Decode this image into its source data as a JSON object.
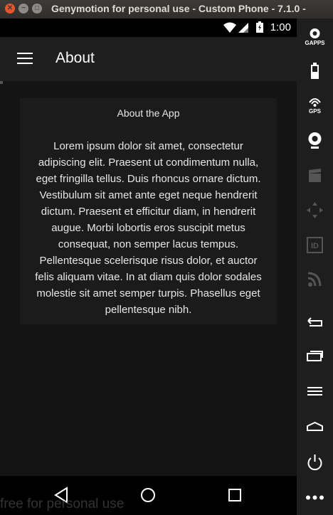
{
  "window": {
    "title": "Genymotion for personal use - Custom Phone - 7.1.0 -"
  },
  "statusbar": {
    "time": "1:00"
  },
  "appbar": {
    "title": "About"
  },
  "card": {
    "title": "About the App",
    "body": "Lorem ipsum dolor sit amet, consectetur adipiscing elit. Praesent ut condimentum nulla, eget fringilla tellus. Duis rhoncus ornare dictum. Vestibulum sit amet ante eget neque hendrerit dictum. Praesent et efficitur diam, in hendrerit augue. Morbi lobortis eros suscipit metus consequat, non semper lacus tempus. Pellentesque scelerisque risus dolor, et auctor felis aliquam vitae. In at diam quis dolor sodales molestie sit amet semper turpis. Phasellus eget pellentesque nibh."
  },
  "watermark": "free for personal use",
  "toolbar": {
    "gapps_label": "GAPPS",
    "gps_label": "GPS"
  },
  "colors": {
    "accent_close": "#e6562e",
    "app_bar": "#1f1f1f",
    "background": "#141414"
  }
}
